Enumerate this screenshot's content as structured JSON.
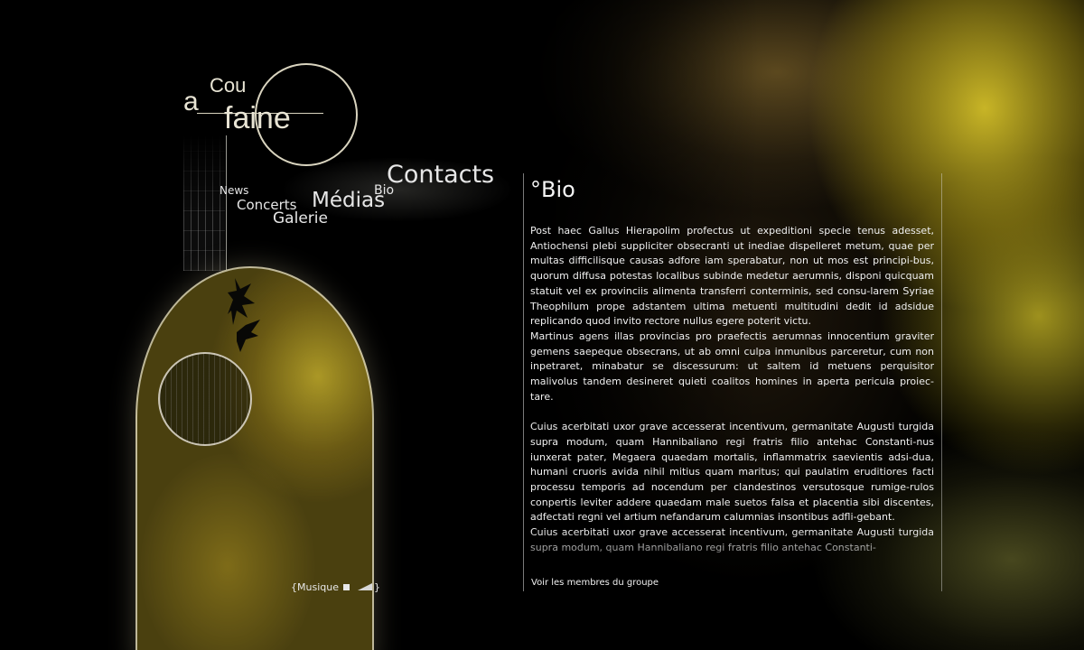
{
  "logo": {
    "prefix": "a",
    "top": "Cou",
    "bottom": "faine"
  },
  "nav": {
    "items": [
      {
        "key": "news",
        "label": "News"
      },
      {
        "key": "concerts",
        "label": "Concerts"
      },
      {
        "key": "galerie",
        "label": "Galerie"
      },
      {
        "key": "medias",
        "label": "Médias"
      },
      {
        "key": "bio",
        "label": "Bio"
      },
      {
        "key": "contacts",
        "label": "Contacts"
      }
    ]
  },
  "music": {
    "open_brace": "{",
    "label": "Musique",
    "close_brace": "}"
  },
  "content": {
    "title": "°Bio",
    "paragraphs": [
      "Post haec Gallus Hierapolim profectus ut expeditioni specie tenus adesset, Antiochensi plebi suppliciter obsecranti ut inediae dispelleret metum, quae per multas difficilisque causas adfore iam sperabatur, non ut mos est principi-bus, quorum diffusa potestas localibus subinde medetur aerumnis, disponi quicquam statuit vel ex provinciis alimenta transferri conterminis, sed consu-larem Syriae Theophilum prope adstantem ultima metuenti multitudini dedit id adsidue replicando quod invito rectore nullus egere poterit victu.",
      "Martinus agens illas provincias pro praefectis aerumnas innocentium graviter gemens saepeque obsecrans, ut ab omni culpa inmunibus parceretur, cum non inpetraret, minabatur se discessurum: ut saltem id metuens perquisitor malivolus tandem desineret quieti coalitos homines in aperta pericula proiec-tare.",
      "Cuius acerbitati uxor grave accesserat incentivum, germanitate Augusti turgida supra modum, quam Hannibaliano regi fratris filio antehac Constanti-nus iunxerat pater, Megaera quaedam mortalis, inflammatrix saevientis adsi-dua, humani cruoris avida nihil mitius quam maritus; qui paulatim eruditiores facti processu temporis ad nocendum per clandestinos versutosque rumige-rulos conpertis leviter addere quaedam male suetos falsa et placentia sibi discentes, adfectati regni vel artium nefandarum calumnias insontibus adfli-gebant.",
      "Cuius acerbitati uxor grave accesserat incentivum, germanitate Augusti turgida supra modum, quam Hannibaliano regi fratris filio antehac Constanti-"
    ],
    "members_link": "Voir les membres du groupe"
  }
}
